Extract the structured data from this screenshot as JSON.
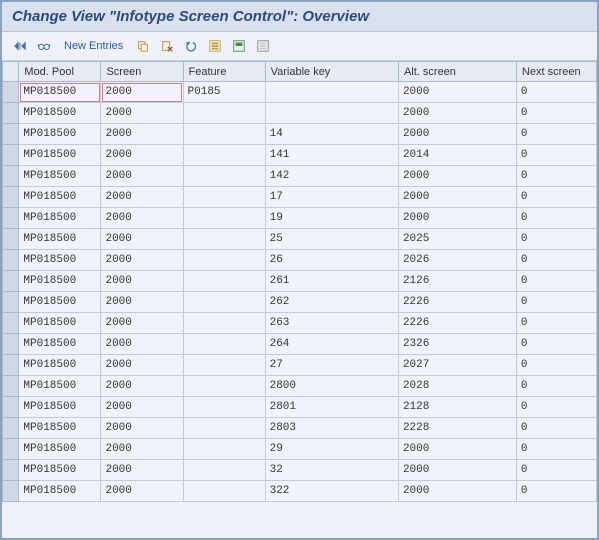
{
  "window_title": "Change View \"Infotype Screen Control\": Overview",
  "toolbar": {
    "new_entries": "New Entries"
  },
  "columns": {
    "mod_pool": "Mod. Pool",
    "screen": "Screen",
    "feature": "Feature",
    "var_key": "Variable key",
    "alt_screen": "Alt. screen",
    "next_screen": "Next screen"
  },
  "rows": [
    {
      "mod": "MP018500",
      "screen": "2000",
      "feature": "P0185",
      "vkey": "",
      "alt": "2000",
      "next": "0"
    },
    {
      "mod": "MP018500",
      "screen": "2000",
      "feature": "",
      "vkey": "",
      "alt": "2000",
      "next": "0"
    },
    {
      "mod": "MP018500",
      "screen": "2000",
      "feature": "",
      "vkey": "14",
      "alt": "2000",
      "next": "0"
    },
    {
      "mod": "MP018500",
      "screen": "2000",
      "feature": "",
      "vkey": "141",
      "alt": "2014",
      "next": "0"
    },
    {
      "mod": "MP018500",
      "screen": "2000",
      "feature": "",
      "vkey": "142",
      "alt": "2000",
      "next": "0"
    },
    {
      "mod": "MP018500",
      "screen": "2000",
      "feature": "",
      "vkey": "17",
      "alt": "2000",
      "next": "0"
    },
    {
      "mod": "MP018500",
      "screen": "2000",
      "feature": "",
      "vkey": "19",
      "alt": "2000",
      "next": "0"
    },
    {
      "mod": "MP018500",
      "screen": "2000",
      "feature": "",
      "vkey": "25",
      "alt": "2025",
      "next": "0"
    },
    {
      "mod": "MP018500",
      "screen": "2000",
      "feature": "",
      "vkey": "26",
      "alt": "2026",
      "next": "0"
    },
    {
      "mod": "MP018500",
      "screen": "2000",
      "feature": "",
      "vkey": "261",
      "alt": "2126",
      "next": "0"
    },
    {
      "mod": "MP018500",
      "screen": "2000",
      "feature": "",
      "vkey": "262",
      "alt": "2226",
      "next": "0"
    },
    {
      "mod": "MP018500",
      "screen": "2000",
      "feature": "",
      "vkey": "263",
      "alt": "2226",
      "next": "0"
    },
    {
      "mod": "MP018500",
      "screen": "2000",
      "feature": "",
      "vkey": "264",
      "alt": "2326",
      "next": "0"
    },
    {
      "mod": "MP018500",
      "screen": "2000",
      "feature": "",
      "vkey": "27",
      "alt": "2027",
      "next": "0"
    },
    {
      "mod": "MP018500",
      "screen": "2000",
      "feature": "",
      "vkey": "2800",
      "alt": "2028",
      "next": "0"
    },
    {
      "mod": "MP018500",
      "screen": "2000",
      "feature": "",
      "vkey": "2801",
      "alt": "2128",
      "next": "0"
    },
    {
      "mod": "MP018500",
      "screen": "2000",
      "feature": "",
      "vkey": "2803",
      "alt": "2228",
      "next": "0"
    },
    {
      "mod": "MP018500",
      "screen": "2000",
      "feature": "",
      "vkey": "29",
      "alt": "2000",
      "next": "0"
    },
    {
      "mod": "MP018500",
      "screen": "2000",
      "feature": "",
      "vkey": "32",
      "alt": "2000",
      "next": "0"
    },
    {
      "mod": "MP018500",
      "screen": "2000",
      "feature": "",
      "vkey": "322",
      "alt": "2000",
      "next": "0"
    }
  ]
}
